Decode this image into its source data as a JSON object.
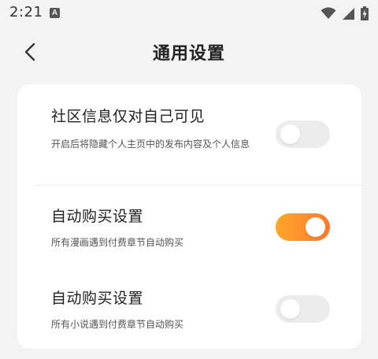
{
  "status_bar": {
    "time": "2:21",
    "notification_icon": "A"
  },
  "header": {
    "title": "通用设置"
  },
  "settings": [
    {
      "title": "社区信息仅对自己可见",
      "description": "开启后将隐藏个人主页中的发布内容及个人信息",
      "enabled": false
    },
    {
      "title": "自动购买设置",
      "description": "所有漫画遇到付费章节自动购买",
      "enabled": true
    },
    {
      "title": "自动购买设置",
      "description": "所有小说遇到付费章节自动购买",
      "enabled": false
    }
  ],
  "colors": {
    "toggle_on_start": "#ffa62a",
    "toggle_on_end": "#ff7a2e",
    "toggle_off": "#ececec"
  }
}
